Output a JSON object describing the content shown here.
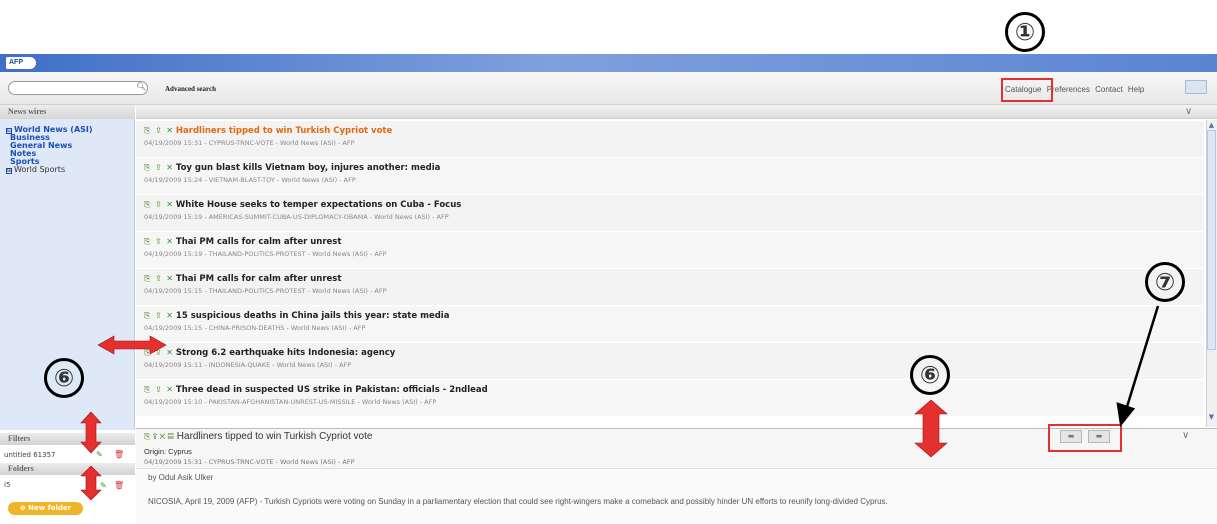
{
  "header": {
    "logo": "AFP"
  },
  "toolbar": {
    "search_placeholder": "",
    "advanced_search": "Advanced search",
    "links": [
      "Catalogue",
      "Preferences",
      "Contact",
      "Help"
    ]
  },
  "sidebar": {
    "news_wires_title": "News wires",
    "items": [
      {
        "label": "World News (ASI)",
        "bold": true,
        "expand": "⊟"
      },
      {
        "label": "Business",
        "bold": true
      },
      {
        "label": "General News",
        "bold": true
      },
      {
        "label": "Notes",
        "bold": true
      },
      {
        "label": "Sports",
        "bold": true
      },
      {
        "label": "World Sports",
        "bold": false,
        "expand": "⊞"
      }
    ],
    "filters_title": "Filters",
    "filter_item": "untitled 61357",
    "folders_title": "Folders",
    "folder_item": "i5",
    "new_folder": "New folder"
  },
  "news": [
    {
      "title": "Hardliners tipped to win Turkish Cypriot vote",
      "meta": "04/19/2009 15:31 - CYPRUS-TRNC-VOTE - World News (ASI) - AFP",
      "highlight": true
    },
    {
      "title": "Toy gun blast kills Vietnam boy, injures another: media",
      "meta": "04/19/2009 15:24 - VIETNAM-BLAST-TOY - World News (ASI) - AFP"
    },
    {
      "title": "White House seeks to temper expectations on Cuba - Focus",
      "meta": "04/19/2009 15:19 - AMERICAS-SUMMIT-CUBA-US-DIPLOMACY-OBAMA - World News (ASI) - AFP"
    },
    {
      "title": "Thai PM calls for calm after unrest",
      "meta": "04/19/2009 15:19 - THAILAND-POLITICS-PROTEST - World News (ASI) - AFP"
    },
    {
      "title": "Thai PM calls for calm after unrest",
      "meta": "04/19/2009 15:15 - THAILAND-POLITICS-PROTEST - World News (ASI) - AFP"
    },
    {
      "title": "15 suspicious deaths in China jails this year: state media",
      "meta": "04/19/2009 15:15 - CHINA-PRISON-DEATHS - World News (ASI) - AFP"
    },
    {
      "title": "Strong 6.2 earthquake hits Indonesia: agency",
      "meta": "04/19/2009 15:11 - INDONESIA-QUAKE - World News (ASI) - AFP"
    },
    {
      "title": "Three dead in suspected US strike in Pakistan: officials - 2ndlead",
      "meta": "04/19/2009 15:10 - PAKISTAN-AFGHANISTAN-UNREST-US-MISSILE - World News (ASI) - AFP"
    }
  ],
  "detail": {
    "title": "Hardliners tipped to win Turkish Cypriot vote",
    "origin": "Origin: Cyprus",
    "meta": "04/19/2009 15:31 - CYPRUS-TRNC-VOTE - World News (ASI) - AFP",
    "byline": "by Odul Asik Ulker",
    "body": "NICOSIA, April 19, 2009 (AFP) - Turkish Cypriots were voting on Sunday in a parliamentary election that could see right-wingers make a comeback and possibly hinder UN efforts to reunify long-divided Cyprus."
  },
  "annotations": {
    "one": "①",
    "six_left": "⑥",
    "six_right": "⑥",
    "seven": "⑦"
  },
  "colors": {
    "accent_blue": "#3f6fc6",
    "highlight_orange": "#e06a12",
    "annotation_red": "#e53030",
    "link_blue": "#1c4fb5"
  }
}
